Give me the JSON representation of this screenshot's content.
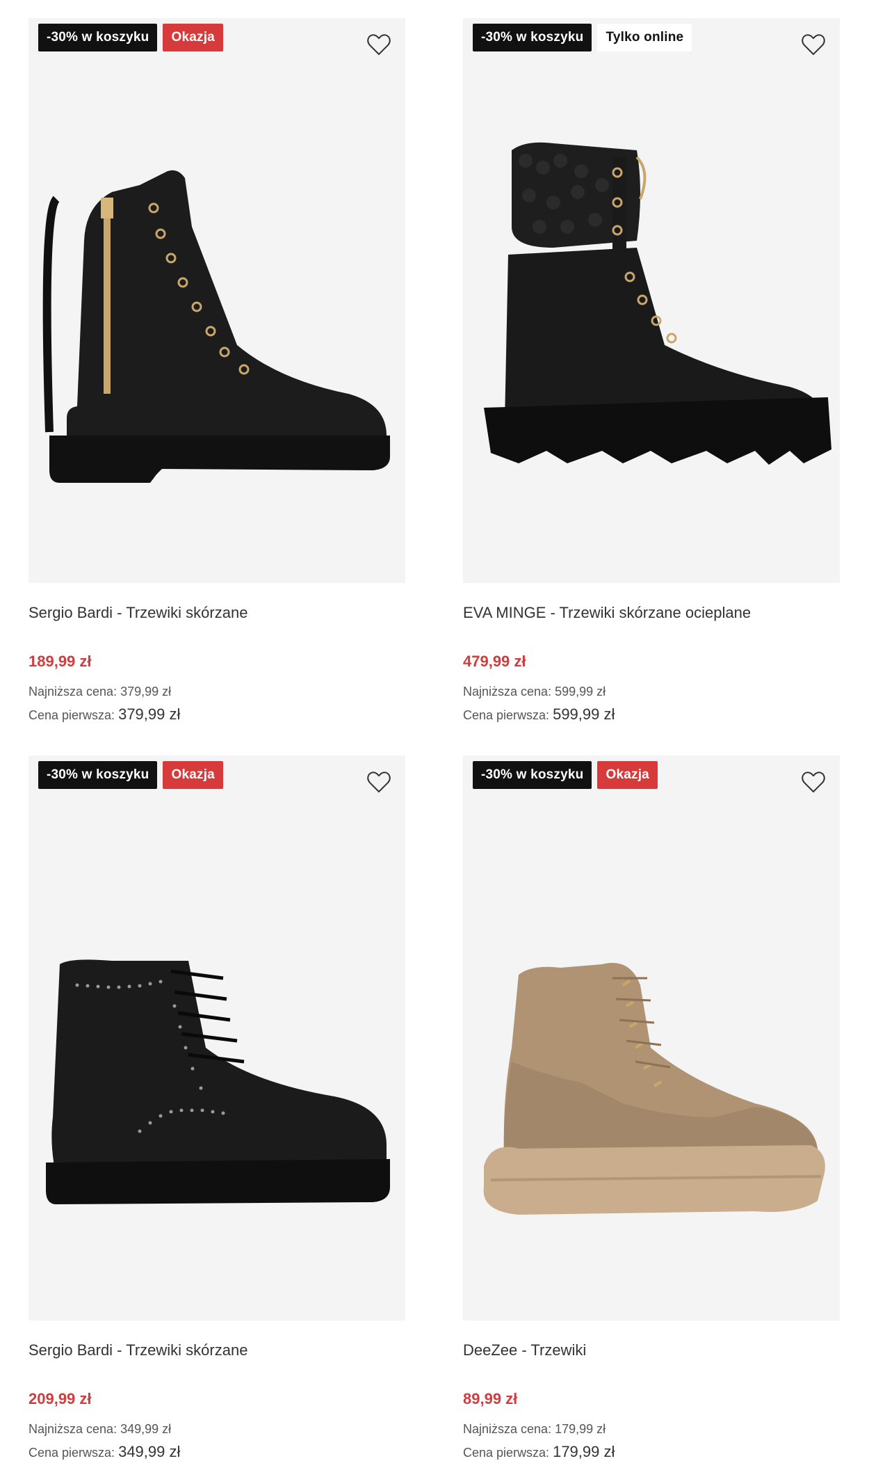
{
  "products": [
    {
      "badges": [
        "-30% w koszyku",
        "Okazja"
      ],
      "title": "Sergio Bardi - Trzewiki skórzane",
      "price": "189,99 zł",
      "lowest_label": "Najniższa cena:",
      "lowest_value": "379,99 zł",
      "first_label": "Cena pierwsza:",
      "first_value": "379,99 zł"
    },
    {
      "badges": [
        "-30% w koszyku",
        "Tylko online"
      ],
      "title": "EVA MINGE - Trzewiki skórzane ocieplane",
      "price": "479,99 zł",
      "lowest_label": "Najniższa cena:",
      "lowest_value": "599,99 zł",
      "first_label": "Cena pierwsza:",
      "first_value": "599,99 zł"
    },
    {
      "badges": [
        "-30% w koszyku",
        "Okazja"
      ],
      "title": "Sergio Bardi - Trzewiki skórzane",
      "price": "209,99 zł",
      "lowest_label": "Najniższa cena:",
      "lowest_value": "349,99 zł",
      "first_label": "Cena pierwsza:",
      "first_value": "349,99 zł"
    },
    {
      "badges": [
        "-30% w koszyku",
        "Okazja"
      ],
      "title": "DeeZee - Trzewiki",
      "price": "89,99 zł",
      "lowest_label": "Najniższa cena:",
      "lowest_value": "179,99 zł",
      "first_label": "Cena pierwsza:",
      "first_value": "179,99 zł"
    }
  ],
  "icons": {
    "wishlist": "heart-outline-icon"
  },
  "colors": {
    "sale_price": "#d23c3c",
    "okazja_badge": "#d63a3a",
    "promo_badge": "#111111",
    "image_bg": "#f4f4f4"
  }
}
